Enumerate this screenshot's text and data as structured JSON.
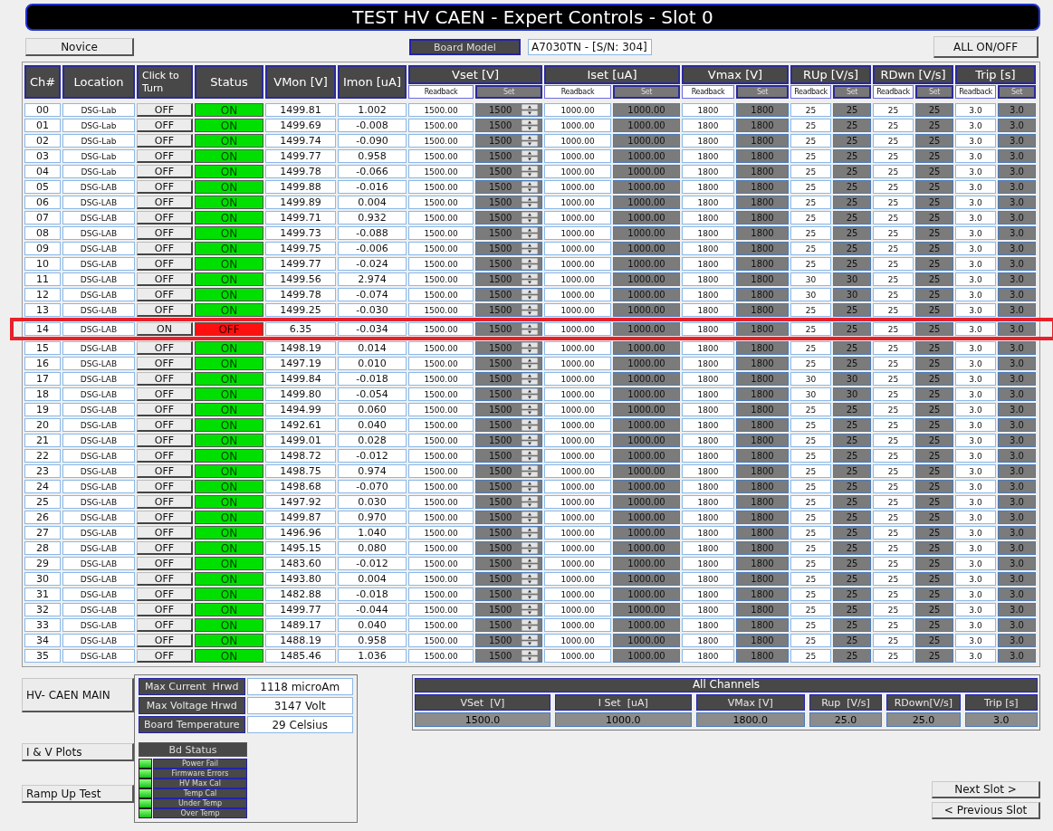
{
  "title": "TEST HV CAEN - Expert Controls - Slot 0",
  "top_bar": {
    "novice_button": "Novice",
    "board_model_label": "Board Model",
    "board_model_value": "A7030TN - [S/N: 304]",
    "all_on_off_button": "ALL ON/OFF"
  },
  "table": {
    "columns": [
      {
        "label": "Ch#",
        "kind": "single"
      },
      {
        "label": "Location",
        "kind": "single"
      },
      {
        "label": "Click to Turn",
        "kind": "single"
      },
      {
        "label": "Status",
        "kind": "single"
      },
      {
        "label": "VMon [V]",
        "kind": "single"
      },
      {
        "label": "Imon [uA]",
        "kind": "single"
      },
      {
        "label": "Vset [V]",
        "kind": "spin_group",
        "sub": [
          "Readback",
          "Set"
        ]
      },
      {
        "label": "Iset [uA]",
        "kind": "group",
        "sub": [
          "Readback",
          "Set"
        ]
      },
      {
        "label": "Vmax [V]",
        "kind": "group",
        "sub": [
          "Readback",
          "Set"
        ]
      },
      {
        "label": "RUp [V/s]",
        "kind": "group",
        "sub": [
          "Readback",
          "Set"
        ]
      },
      {
        "label": "RDwn [V/s]",
        "kind": "group",
        "sub": [
          "Readback",
          "Set"
        ]
      },
      {
        "label": "Trip [s]",
        "kind": "group",
        "sub": [
          "Readback",
          "Set"
        ]
      }
    ],
    "rows": [
      {
        "ch": "00",
        "location": "DSG-Lab",
        "turn": "OFF",
        "status": "ON",
        "on": true,
        "highlighted": false,
        "vmon": "1499.81",
        "imon": "1.002",
        "settings": [
          [
            "1500.00",
            "1500"
          ],
          [
            "1000.00",
            "1000.00"
          ],
          [
            "1800",
            "1800"
          ],
          [
            "25",
            "25"
          ],
          [
            "25",
            "25"
          ],
          [
            "3.0",
            "3.0"
          ]
        ]
      },
      {
        "ch": "01",
        "location": "DSG-Lab",
        "turn": "OFF",
        "status": "ON",
        "on": true,
        "highlighted": false,
        "vmon": "1499.69",
        "imon": "-0.008",
        "settings": [
          [
            "1500.00",
            "1500"
          ],
          [
            "1000.00",
            "1000.00"
          ],
          [
            "1800",
            "1800"
          ],
          [
            "25",
            "25"
          ],
          [
            "25",
            "25"
          ],
          [
            "3.0",
            "3.0"
          ]
        ]
      },
      {
        "ch": "02",
        "location": "DSG-Lab",
        "turn": "OFF",
        "status": "ON",
        "on": true,
        "highlighted": false,
        "vmon": "1499.74",
        "imon": "-0.090",
        "settings": [
          [
            "1500.00",
            "1500"
          ],
          [
            "1000.00",
            "1000.00"
          ],
          [
            "1800",
            "1800"
          ],
          [
            "25",
            "25"
          ],
          [
            "25",
            "25"
          ],
          [
            "3.0",
            "3.0"
          ]
        ]
      },
      {
        "ch": "03",
        "location": "DSG-Lab",
        "turn": "OFF",
        "status": "ON",
        "on": true,
        "highlighted": false,
        "vmon": "1499.77",
        "imon": "0.958",
        "settings": [
          [
            "1500.00",
            "1500"
          ],
          [
            "1000.00",
            "1000.00"
          ],
          [
            "1800",
            "1800"
          ],
          [
            "25",
            "25"
          ],
          [
            "25",
            "25"
          ],
          [
            "3.0",
            "3.0"
          ]
        ]
      },
      {
        "ch": "04",
        "location": "DSG-Lab",
        "turn": "OFF",
        "status": "ON",
        "on": true,
        "highlighted": false,
        "vmon": "1499.78",
        "imon": "-0.066",
        "settings": [
          [
            "1500.00",
            "1500"
          ],
          [
            "1000.00",
            "1000.00"
          ],
          [
            "1800",
            "1800"
          ],
          [
            "25",
            "25"
          ],
          [
            "25",
            "25"
          ],
          [
            "3.0",
            "3.0"
          ]
        ]
      },
      {
        "ch": "05",
        "location": "DSG-LAB",
        "turn": "OFF",
        "status": "ON",
        "on": true,
        "highlighted": false,
        "vmon": "1499.88",
        "imon": "-0.016",
        "settings": [
          [
            "1500.00",
            "1500"
          ],
          [
            "1000.00",
            "1000.00"
          ],
          [
            "1800",
            "1800"
          ],
          [
            "25",
            "25"
          ],
          [
            "25",
            "25"
          ],
          [
            "3.0",
            "3.0"
          ]
        ]
      },
      {
        "ch": "06",
        "location": "DSG-LAB",
        "turn": "OFF",
        "status": "ON",
        "on": true,
        "highlighted": false,
        "vmon": "1499.89",
        "imon": "0.004",
        "settings": [
          [
            "1500.00",
            "1500"
          ],
          [
            "1000.00",
            "1000.00"
          ],
          [
            "1800",
            "1800"
          ],
          [
            "25",
            "25"
          ],
          [
            "25",
            "25"
          ],
          [
            "3.0",
            "3.0"
          ]
        ]
      },
      {
        "ch": "07",
        "location": "DSG-LAB",
        "turn": "OFF",
        "status": "ON",
        "on": true,
        "highlighted": false,
        "vmon": "1499.71",
        "imon": "0.932",
        "settings": [
          [
            "1500.00",
            "1500"
          ],
          [
            "1000.00",
            "1000.00"
          ],
          [
            "1800",
            "1800"
          ],
          [
            "25",
            "25"
          ],
          [
            "25",
            "25"
          ],
          [
            "3.0",
            "3.0"
          ]
        ]
      },
      {
        "ch": "08",
        "location": "DSG-LAB",
        "turn": "OFF",
        "status": "ON",
        "on": true,
        "highlighted": false,
        "vmon": "1499.73",
        "imon": "-0.088",
        "settings": [
          [
            "1500.00",
            "1500"
          ],
          [
            "1000.00",
            "1000.00"
          ],
          [
            "1800",
            "1800"
          ],
          [
            "25",
            "25"
          ],
          [
            "25",
            "25"
          ],
          [
            "3.0",
            "3.0"
          ]
        ]
      },
      {
        "ch": "09",
        "location": "DSG-LAB",
        "turn": "OFF",
        "status": "ON",
        "on": true,
        "highlighted": false,
        "vmon": "1499.75",
        "imon": "-0.006",
        "settings": [
          [
            "1500.00",
            "1500"
          ],
          [
            "1000.00",
            "1000.00"
          ],
          [
            "1800",
            "1800"
          ],
          [
            "25",
            "25"
          ],
          [
            "25",
            "25"
          ],
          [
            "3.0",
            "3.0"
          ]
        ]
      },
      {
        "ch": "10",
        "location": "DSG-LAB",
        "turn": "OFF",
        "status": "ON",
        "on": true,
        "highlighted": false,
        "vmon": "1499.77",
        "imon": "-0.024",
        "settings": [
          [
            "1500.00",
            "1500"
          ],
          [
            "1000.00",
            "1000.00"
          ],
          [
            "1800",
            "1800"
          ],
          [
            "25",
            "25"
          ],
          [
            "25",
            "25"
          ],
          [
            "3.0",
            "3.0"
          ]
        ]
      },
      {
        "ch": "11",
        "location": "DSG-LAB",
        "turn": "OFF",
        "status": "ON",
        "on": true,
        "highlighted": false,
        "vmon": "1499.56",
        "imon": "2.974",
        "settings": [
          [
            "1500.00",
            "1500"
          ],
          [
            "1000.00",
            "1000.00"
          ],
          [
            "1800",
            "1800"
          ],
          [
            "30",
            "30"
          ],
          [
            "25",
            "25"
          ],
          [
            "3.0",
            "3.0"
          ]
        ]
      },
      {
        "ch": "12",
        "location": "DSG-LAB",
        "turn": "OFF",
        "status": "ON",
        "on": true,
        "highlighted": false,
        "vmon": "1499.78",
        "imon": "-0.074",
        "settings": [
          [
            "1500.00",
            "1500"
          ],
          [
            "1000.00",
            "1000.00"
          ],
          [
            "1800",
            "1800"
          ],
          [
            "30",
            "30"
          ],
          [
            "25",
            "25"
          ],
          [
            "3.0",
            "3.0"
          ]
        ]
      },
      {
        "ch": "13",
        "location": "DSG-LAB",
        "turn": "OFF",
        "status": "ON",
        "on": true,
        "highlighted": false,
        "vmon": "1499.25",
        "imon": "-0.030",
        "settings": [
          [
            "1500.00",
            "1500"
          ],
          [
            "1000.00",
            "1000.00"
          ],
          [
            "1800",
            "1800"
          ],
          [
            "25",
            "25"
          ],
          [
            "25",
            "25"
          ],
          [
            "3.0",
            "3.0"
          ]
        ]
      },
      {
        "ch": "14",
        "location": "DSG-LAB",
        "turn": "ON",
        "status": "OFF",
        "on": false,
        "highlighted": true,
        "vmon": "6.35",
        "imon": "-0.034",
        "settings": [
          [
            "1500.00",
            "1500"
          ],
          [
            "1000.00",
            "1000.00"
          ],
          [
            "1800",
            "1800"
          ],
          [
            "25",
            "25"
          ],
          [
            "25",
            "25"
          ],
          [
            "3.0",
            "3.0"
          ]
        ]
      },
      {
        "ch": "15",
        "location": "DSG-LAB",
        "turn": "OFF",
        "status": "ON",
        "on": true,
        "highlighted": false,
        "vmon": "1498.19",
        "imon": "0.014",
        "settings": [
          [
            "1500.00",
            "1500"
          ],
          [
            "1000.00",
            "1000.00"
          ],
          [
            "1800",
            "1800"
          ],
          [
            "25",
            "25"
          ],
          [
            "25",
            "25"
          ],
          [
            "3.0",
            "3.0"
          ]
        ]
      },
      {
        "ch": "16",
        "location": "DSG-LAB",
        "turn": "OFF",
        "status": "ON",
        "on": true,
        "highlighted": false,
        "vmon": "1497.19",
        "imon": "0.010",
        "settings": [
          [
            "1500.00",
            "1500"
          ],
          [
            "1000.00",
            "1000.00"
          ],
          [
            "1800",
            "1800"
          ],
          [
            "25",
            "25"
          ],
          [
            "25",
            "25"
          ],
          [
            "3.0",
            "3.0"
          ]
        ]
      },
      {
        "ch": "17",
        "location": "DSG-LAB",
        "turn": "OFF",
        "status": "ON",
        "on": true,
        "highlighted": false,
        "vmon": "1499.84",
        "imon": "-0.018",
        "settings": [
          [
            "1500.00",
            "1500"
          ],
          [
            "1000.00",
            "1000.00"
          ],
          [
            "1800",
            "1800"
          ],
          [
            "30",
            "30"
          ],
          [
            "25",
            "25"
          ],
          [
            "3.0",
            "3.0"
          ]
        ]
      },
      {
        "ch": "18",
        "location": "DSG-LAB",
        "turn": "OFF",
        "status": "ON",
        "on": true,
        "highlighted": false,
        "vmon": "1499.80",
        "imon": "-0.054",
        "settings": [
          [
            "1500.00",
            "1500"
          ],
          [
            "1000.00",
            "1000.00"
          ],
          [
            "1800",
            "1800"
          ],
          [
            "30",
            "30"
          ],
          [
            "25",
            "25"
          ],
          [
            "3.0",
            "3.0"
          ]
        ]
      },
      {
        "ch": "19",
        "location": "DSG-LAB",
        "turn": "OFF",
        "status": "ON",
        "on": true,
        "highlighted": false,
        "vmon": "1494.99",
        "imon": "0.060",
        "settings": [
          [
            "1500.00",
            "1500"
          ],
          [
            "1000.00",
            "1000.00"
          ],
          [
            "1800",
            "1800"
          ],
          [
            "25",
            "25"
          ],
          [
            "25",
            "25"
          ],
          [
            "3.0",
            "3.0"
          ]
        ]
      },
      {
        "ch": "20",
        "location": "DSG-LAB",
        "turn": "OFF",
        "status": "ON",
        "on": true,
        "highlighted": false,
        "vmon": "1492.61",
        "imon": "0.040",
        "settings": [
          [
            "1500.00",
            "1500"
          ],
          [
            "1000.00",
            "1000.00"
          ],
          [
            "1800",
            "1800"
          ],
          [
            "25",
            "25"
          ],
          [
            "25",
            "25"
          ],
          [
            "3.0",
            "3.0"
          ]
        ]
      },
      {
        "ch": "21",
        "location": "DSG-LAB",
        "turn": "OFF",
        "status": "ON",
        "on": true,
        "highlighted": false,
        "vmon": "1499.01",
        "imon": "0.028",
        "settings": [
          [
            "1500.00",
            "1500"
          ],
          [
            "1000.00",
            "1000.00"
          ],
          [
            "1800",
            "1800"
          ],
          [
            "25",
            "25"
          ],
          [
            "25",
            "25"
          ],
          [
            "3.0",
            "3.0"
          ]
        ]
      },
      {
        "ch": "22",
        "location": "DSG-LAB",
        "turn": "OFF",
        "status": "ON",
        "on": true,
        "highlighted": false,
        "vmon": "1498.72",
        "imon": "-0.012",
        "settings": [
          [
            "1500.00",
            "1500"
          ],
          [
            "1000.00",
            "1000.00"
          ],
          [
            "1800",
            "1800"
          ],
          [
            "25",
            "25"
          ],
          [
            "25",
            "25"
          ],
          [
            "3.0",
            "3.0"
          ]
        ]
      },
      {
        "ch": "23",
        "location": "DSG-LAB",
        "turn": "OFF",
        "status": "ON",
        "on": true,
        "highlighted": false,
        "vmon": "1498.75",
        "imon": "0.974",
        "settings": [
          [
            "1500.00",
            "1500"
          ],
          [
            "1000.00",
            "1000.00"
          ],
          [
            "1800",
            "1800"
          ],
          [
            "25",
            "25"
          ],
          [
            "25",
            "25"
          ],
          [
            "3.0",
            "3.0"
          ]
        ]
      },
      {
        "ch": "24",
        "location": "DSG-LAB",
        "turn": "OFF",
        "status": "ON",
        "on": true,
        "highlighted": false,
        "vmon": "1498.68",
        "imon": "-0.070",
        "settings": [
          [
            "1500.00",
            "1500"
          ],
          [
            "1000.00",
            "1000.00"
          ],
          [
            "1800",
            "1800"
          ],
          [
            "25",
            "25"
          ],
          [
            "25",
            "25"
          ],
          [
            "3.0",
            "3.0"
          ]
        ]
      },
      {
        "ch": "25",
        "location": "DSG-LAB",
        "turn": "OFF",
        "status": "ON",
        "on": true,
        "highlighted": false,
        "vmon": "1497.92",
        "imon": "0.030",
        "settings": [
          [
            "1500.00",
            "1500"
          ],
          [
            "1000.00",
            "1000.00"
          ],
          [
            "1800",
            "1800"
          ],
          [
            "25",
            "25"
          ],
          [
            "25",
            "25"
          ],
          [
            "3.0",
            "3.0"
          ]
        ]
      },
      {
        "ch": "26",
        "location": "DSG-LAB",
        "turn": "OFF",
        "status": "ON",
        "on": true,
        "highlighted": false,
        "vmon": "1499.87",
        "imon": "0.970",
        "settings": [
          [
            "1500.00",
            "1500"
          ],
          [
            "1000.00",
            "1000.00"
          ],
          [
            "1800",
            "1800"
          ],
          [
            "25",
            "25"
          ],
          [
            "25",
            "25"
          ],
          [
            "3.0",
            "3.0"
          ]
        ]
      },
      {
        "ch": "27",
        "location": "DSG-LAB",
        "turn": "OFF",
        "status": "ON",
        "on": true,
        "highlighted": false,
        "vmon": "1496.96",
        "imon": "1.040",
        "settings": [
          [
            "1500.00",
            "1500"
          ],
          [
            "1000.00",
            "1000.00"
          ],
          [
            "1800",
            "1800"
          ],
          [
            "25",
            "25"
          ],
          [
            "25",
            "25"
          ],
          [
            "3.0",
            "3.0"
          ]
        ]
      },
      {
        "ch": "28",
        "location": "DSG-LAB",
        "turn": "OFF",
        "status": "ON",
        "on": true,
        "highlighted": false,
        "vmon": "1495.15",
        "imon": "0.080",
        "settings": [
          [
            "1500.00",
            "1500"
          ],
          [
            "1000.00",
            "1000.00"
          ],
          [
            "1800",
            "1800"
          ],
          [
            "25",
            "25"
          ],
          [
            "25",
            "25"
          ],
          [
            "3.0",
            "3.0"
          ]
        ]
      },
      {
        "ch": "29",
        "location": "DSG-LAB",
        "turn": "OFF",
        "status": "ON",
        "on": true,
        "highlighted": false,
        "vmon": "1483.60",
        "imon": "-0.012",
        "settings": [
          [
            "1500.00",
            "1500"
          ],
          [
            "1000.00",
            "1000.00"
          ],
          [
            "1800",
            "1800"
          ],
          [
            "25",
            "25"
          ],
          [
            "25",
            "25"
          ],
          [
            "3.0",
            "3.0"
          ]
        ]
      },
      {
        "ch": "30",
        "location": "DSG-LAB",
        "turn": "OFF",
        "status": "ON",
        "on": true,
        "highlighted": false,
        "vmon": "1493.80",
        "imon": "0.004",
        "settings": [
          [
            "1500.00",
            "1500"
          ],
          [
            "1000.00",
            "1000.00"
          ],
          [
            "1800",
            "1800"
          ],
          [
            "25",
            "25"
          ],
          [
            "25",
            "25"
          ],
          [
            "3.0",
            "3.0"
          ]
        ]
      },
      {
        "ch": "31",
        "location": "DSG-LAB",
        "turn": "OFF",
        "status": "ON",
        "on": true,
        "highlighted": false,
        "vmon": "1482.88",
        "imon": "-0.018",
        "settings": [
          [
            "1500.00",
            "1500"
          ],
          [
            "1000.00",
            "1000.00"
          ],
          [
            "1800",
            "1800"
          ],
          [
            "25",
            "25"
          ],
          [
            "25",
            "25"
          ],
          [
            "3.0",
            "3.0"
          ]
        ]
      },
      {
        "ch": "32",
        "location": "DSG-LAB",
        "turn": "OFF",
        "status": "ON",
        "on": true,
        "highlighted": false,
        "vmon": "1499.77",
        "imon": "-0.044",
        "settings": [
          [
            "1500.00",
            "1500"
          ],
          [
            "1000.00",
            "1000.00"
          ],
          [
            "1800",
            "1800"
          ],
          [
            "25",
            "25"
          ],
          [
            "25",
            "25"
          ],
          [
            "3.0",
            "3.0"
          ]
        ]
      },
      {
        "ch": "33",
        "location": "DSG-LAB",
        "turn": "OFF",
        "status": "ON",
        "on": true,
        "highlighted": false,
        "vmon": "1489.17",
        "imon": "0.040",
        "settings": [
          [
            "1500.00",
            "1500"
          ],
          [
            "1000.00",
            "1000.00"
          ],
          [
            "1800",
            "1800"
          ],
          [
            "25",
            "25"
          ],
          [
            "25",
            "25"
          ],
          [
            "3.0",
            "3.0"
          ]
        ]
      },
      {
        "ch": "34",
        "location": "DSG-LAB",
        "turn": "OFF",
        "status": "ON",
        "on": true,
        "highlighted": false,
        "vmon": "1488.19",
        "imon": "0.958",
        "settings": [
          [
            "1500.00",
            "1500"
          ],
          [
            "1000.00",
            "1000.00"
          ],
          [
            "1800",
            "1800"
          ],
          [
            "25",
            "25"
          ],
          [
            "25",
            "25"
          ],
          [
            "3.0",
            "3.0"
          ]
        ]
      },
      {
        "ch": "35",
        "location": "DSG-LAB",
        "turn": "OFF",
        "status": "ON",
        "on": true,
        "highlighted": false,
        "vmon": "1485.46",
        "imon": "1.036",
        "settings": [
          [
            "1500.00",
            "1500"
          ],
          [
            "1000.00",
            "1000.00"
          ],
          [
            "1800",
            "1800"
          ],
          [
            "25",
            "25"
          ],
          [
            "25",
            "25"
          ],
          [
            "3.0",
            "3.0"
          ]
        ]
      }
    ]
  },
  "side_buttons": [
    "HV- CAEN MAIN",
    "I & V Plots",
    "Ramp Up Test"
  ],
  "board_info": [
    {
      "label": "Max Current  Hrwd",
      "value": "1118 microAm"
    },
    {
      "label": "Max Voltage Hrwd",
      "value": "3147 Volt"
    },
    {
      "label": "Board Temperature",
      "value": "29 Celsius"
    }
  ],
  "bd_status": {
    "title": "Bd Status",
    "items": [
      {
        "label": "Power Fail",
        "on": true
      },
      {
        "label": "Firmware Errors",
        "on": true
      },
      {
        "label": "HV Max Cal",
        "on": true
      },
      {
        "label": "Temp Cal",
        "on": true
      },
      {
        "label": "Under Temp",
        "on": true
      },
      {
        "label": "Over Temp",
        "on": true
      }
    ]
  },
  "all_channels": {
    "title": "All Channels",
    "fields": [
      {
        "label": "VSet  [V]",
        "value": "1500.0"
      },
      {
        "label": "I Set  [uA]",
        "value": "1000.0"
      },
      {
        "label": "VMax [V]",
        "value": "1800.0"
      },
      {
        "label": "Rup  [V/s]",
        "value": "25.0"
      },
      {
        "label": "RDown[V/s]",
        "value": "25.0"
      },
      {
        "label": "Trip [s]",
        "value": "3.0"
      }
    ]
  },
  "slot_buttons": [
    "Next Slot >",
    "< Previous Slot"
  ]
}
